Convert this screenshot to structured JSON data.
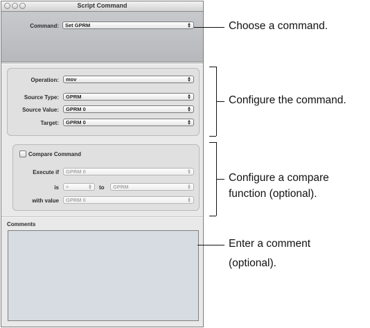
{
  "window": {
    "title": "Script Command"
  },
  "command": {
    "label": "Command:",
    "value": "Set GPRM"
  },
  "operation_group": {
    "operation_label": "Operation:",
    "operation_value": "mov",
    "source_type_label": "Source Type:",
    "source_type_value": "GPRM",
    "source_value_label": "Source Value:",
    "source_value_value": "GPRM 0",
    "target_label": "Target:",
    "target_value": "GPRM 0"
  },
  "compare_group": {
    "checkbox_label": "Compare Command",
    "execute_if_label": "Execute if",
    "execute_if_value": "GPRM 0",
    "is_label": "is",
    "is_value": "=",
    "to_label": "to",
    "to_value": "GPRM",
    "with_value_label": "with value",
    "with_value_value": "GPRM 0"
  },
  "comments": {
    "label": "Comments",
    "value": ""
  },
  "callouts": {
    "choose_command": "Choose a command.",
    "configure_command": "Configure the command.",
    "configure_compare_line1": "Configure a compare",
    "configure_compare_line2": "function (optional).",
    "enter_comment_line1": "Enter a comment",
    "enter_comment_line2": "(optional)."
  }
}
